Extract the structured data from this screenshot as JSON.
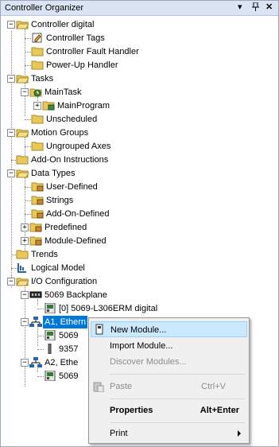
{
  "panel": {
    "title": "Controller Organizer",
    "controls": {
      "dropdown": "▾",
      "pin": "ᵖ",
      "close": "✕"
    }
  },
  "tree": {
    "controller": "Controller digital",
    "controller_tags": "Controller Tags",
    "fault_handler": "Controller Fault Handler",
    "powerup_handler": "Power-Up Handler",
    "tasks": "Tasks",
    "main_task": "MainTask",
    "main_program": "MainProgram",
    "unscheduled": "Unscheduled",
    "motion_groups": "Motion Groups",
    "ungrouped_axes": "Ungrouped Axes",
    "aoi": "Add-On Instructions",
    "data_types": "Data Types",
    "user_defined": "User-Defined",
    "strings": "Strings",
    "addon_defined": "Add-On-Defined",
    "predefined": "Predefined",
    "module_defined": "Module-Defined",
    "trends": "Trends",
    "logical_model": "Logical Model",
    "io_config": "I/O Configuration",
    "backplane": "5069 Backplane",
    "controller_module": "[0] 5069-L306ERM digital",
    "a1_ethernet": "A1, Ethern",
    "a1_child1": "5069",
    "a1_child2": "9357",
    "a2_ethernet": "A2, Ethe",
    "a2_child1": "5069"
  },
  "context_menu": {
    "new_module": "New Module...",
    "import_module": "Import Module...",
    "discover_modules": "Discover Modules...",
    "paste": "Paste",
    "paste_shortcut": "Ctrl+V",
    "properties": "Properties",
    "properties_shortcut": "Alt+Enter",
    "print": "Print"
  },
  "colors": {
    "folder": "#e8c85a",
    "selection": "#0078d7",
    "menu_highlight": "#cce8ff",
    "titlebar": "#dbe4f3"
  }
}
